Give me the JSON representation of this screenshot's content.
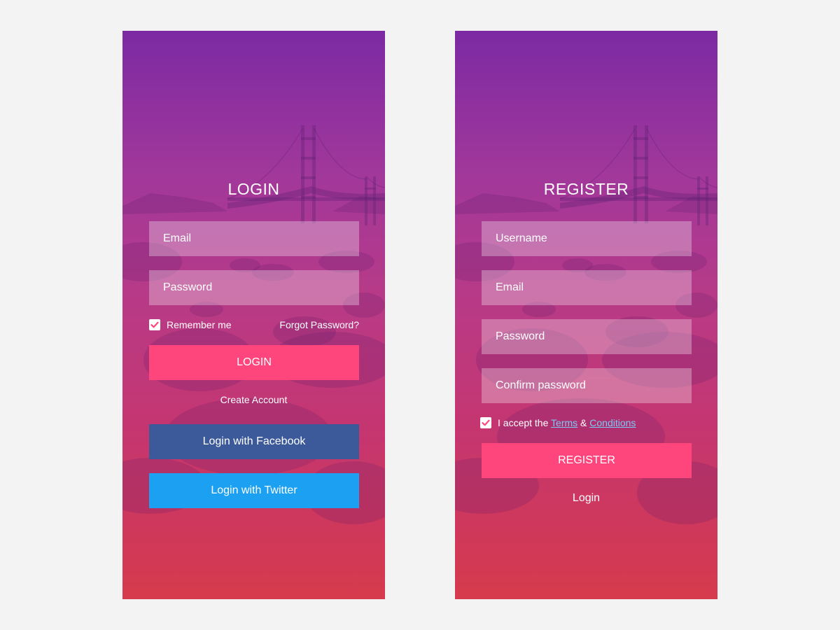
{
  "colors": {
    "page_background": "#f3f3f3",
    "gradient_top": "#7c2aa3",
    "gradient_bottom": "#d63a4c",
    "primary_button": "#fe467d",
    "facebook_button": "#3c5a99",
    "twitter_button": "#1ca1f2",
    "link_highlight": "#7ec8f5"
  },
  "login_screen": {
    "title": "LOGIN",
    "email_placeholder": "Email",
    "password_placeholder": "Password",
    "remember_me_label": "Remember me",
    "remember_me_checked": true,
    "forgot_password_label": "Forgot Password?",
    "login_button_label": "LOGIN",
    "create_account_label": "Create Account",
    "facebook_button_label": "Login with Facebook",
    "twitter_button_label": "Login with Twitter"
  },
  "register_screen": {
    "title": "REGISTER",
    "username_placeholder": "Username",
    "email_placeholder": "Email",
    "password_placeholder": "Password",
    "confirm_password_placeholder": "Confirm password",
    "terms_checked": true,
    "terms_prefix": "I accept the",
    "terms_link": "Terms",
    "terms_ampersand": "&",
    "conditions_link": "Conditions",
    "register_button_label": "REGISTER",
    "login_link_label": "Login"
  }
}
